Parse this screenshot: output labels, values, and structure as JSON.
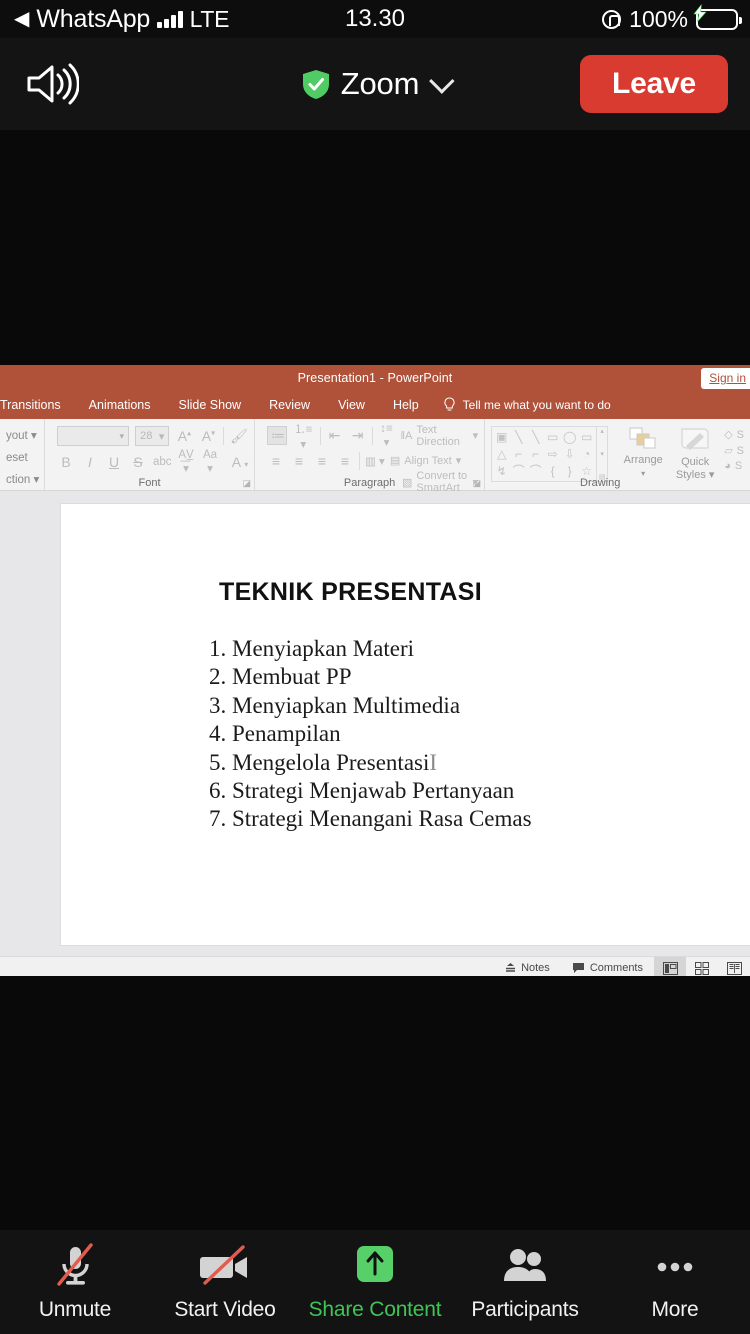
{
  "status_bar": {
    "back_label": "WhatsApp",
    "back_arrow": "◀",
    "network": "LTE",
    "time": "13.30",
    "battery_percent": "100%",
    "signal_icon": "signal-bars-icon",
    "lock_icon": "orientation-lock-icon",
    "battery_icon": "battery-charging-icon",
    "battery_color": "#41d35c"
  },
  "zoom_nav": {
    "speaker_icon": "speaker-on-icon",
    "shield_icon": "shield-check-icon",
    "shield_color": "#4fcc63",
    "title": "Zoom",
    "chevron_icon": "chevron-down-icon",
    "leave_label": "Leave",
    "leave_color": "#d93b30"
  },
  "powerpoint": {
    "title": "Presentation1  -  PowerPoint",
    "sign_in": "Sign in",
    "theme_color": "#b0523a",
    "tabs": [
      {
        "label": "Transitions"
      },
      {
        "label": "Animations"
      },
      {
        "label": "Slide Show"
      },
      {
        "label": "Review"
      },
      {
        "label": "View"
      },
      {
        "label": "Help"
      }
    ],
    "tell_me": "Tell me what you want to do",
    "tell_me_icon": "lightbulb-icon",
    "ribbon": {
      "slide_group": {
        "layout": "yout",
        "reset": "eset",
        "section": "ction"
      },
      "font_group": {
        "label": "Font",
        "font_name": "",
        "font_size": "28",
        "grow_icon": "increase-font-size-icon",
        "shrink_icon": "decrease-font-size-icon",
        "clear_icon": "clear-formatting-icon",
        "bold": "B",
        "italic": "I",
        "underline": "U",
        "strike": "S",
        "shadow": "abc",
        "spacing_icon": "character-spacing-icon",
        "case_label": "Aa",
        "color_label": "A"
      },
      "paragraph_group": {
        "label": "Paragraph",
        "text_direction": "Text Direction",
        "align_text": "Align Text",
        "convert_smartart": "Convert to SmartArt"
      },
      "drawing_group": {
        "label": "Drawing",
        "arrange": "Arrange",
        "quick_styles": "Quick\nStyles",
        "shape_fill": "S",
        "shape_outline": "S",
        "shape_effects": "S",
        "shapes": [
          "▣",
          "╲",
          "╲",
          "▭",
          "◯",
          "▭",
          "△",
          "⌐",
          "⌐",
          "⇨",
          "⇩",
          "◔",
          "↯",
          "⌒",
          "⌒",
          "{",
          "}",
          "☆"
        ]
      }
    },
    "slide": {
      "title": "TEKNIK PRESENTASI",
      "items": [
        "1. Menyiapkan Materi",
        "2. Membuat PP",
        "3. Menyiapkan Multimedia",
        "4. Penampilan",
        "5. Mengelola Presentasi",
        "6. Strategi Menjawab Pertanyaan",
        "7. Strategi Menangani Rasa Cemas"
      ],
      "cursor_after_item": 5,
      "cursor_glyph": "I"
    },
    "status_bar": {
      "notes": "Notes",
      "comments": "Comments",
      "notes_icon": "notes-icon",
      "comments_icon": "comment-bubble-icon",
      "views": [
        {
          "name": "normal-view",
          "active": true
        },
        {
          "name": "slide-sorter-view",
          "active": false
        },
        {
          "name": "reading-view",
          "active": false
        }
      ]
    }
  },
  "bottom_bar": {
    "items": [
      {
        "label": "Unmute",
        "icon": "microphone-muted-icon",
        "highlight": false
      },
      {
        "label": "Start Video",
        "icon": "camera-off-icon",
        "highlight": false
      },
      {
        "label": "Share Content",
        "icon": "share-content-icon",
        "highlight": true
      },
      {
        "label": "Participants",
        "icon": "participants-icon",
        "highlight": false
      },
      {
        "label": "More",
        "icon": "more-dots-icon",
        "highlight": false
      }
    ],
    "highlight_color": "#3ec457"
  }
}
